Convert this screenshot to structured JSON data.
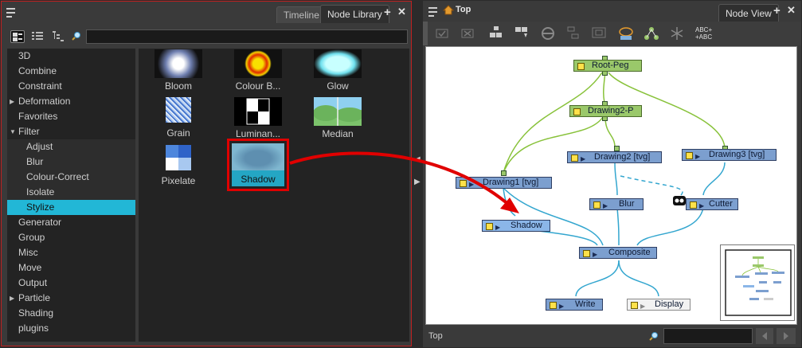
{
  "left_panel": {
    "tabs": [
      {
        "label": "Timeline"
      },
      {
        "label": "Node Library"
      }
    ],
    "add_label": "+",
    "close_label": "✕",
    "search": {
      "value": "",
      "placeholder": ""
    },
    "categories": [
      {
        "label": "3D",
        "level": 0,
        "expander": ""
      },
      {
        "label": "Combine",
        "level": 0,
        "expander": ""
      },
      {
        "label": "Constraint",
        "level": 0,
        "expander": ""
      },
      {
        "label": "Deformation",
        "level": 0,
        "expander": "▶"
      },
      {
        "label": "Favorites",
        "level": 0,
        "expander": ""
      },
      {
        "label": "Filter",
        "level": 0,
        "expander": "▼"
      },
      {
        "label": "Adjust",
        "level": 1,
        "expander": ""
      },
      {
        "label": "Blur",
        "level": 1,
        "expander": ""
      },
      {
        "label": "Colour-Correct",
        "level": 1,
        "expander": ""
      },
      {
        "label": "Isolate",
        "level": 1,
        "expander": ""
      },
      {
        "label": "Stylize",
        "level": 1,
        "expander": "",
        "selected": true
      },
      {
        "label": "Generator",
        "level": 0,
        "expander": ""
      },
      {
        "label": "Group",
        "level": 0,
        "expander": ""
      },
      {
        "label": "Misc",
        "level": 0,
        "expander": ""
      },
      {
        "label": "Move",
        "level": 0,
        "expander": ""
      },
      {
        "label": "Output",
        "level": 0,
        "expander": ""
      },
      {
        "label": "Particle",
        "level": 0,
        "expander": "▶"
      },
      {
        "label": "Shading",
        "level": 0,
        "expander": ""
      },
      {
        "label": "plugins",
        "level": 0,
        "expander": ""
      }
    ],
    "nodes": [
      {
        "label": "Bloom"
      },
      {
        "label": "Colour B..."
      },
      {
        "label": "Glow"
      },
      {
        "label": "Grain"
      },
      {
        "label": "Luminan..."
      },
      {
        "label": "Median"
      },
      {
        "label": "Pixelate"
      },
      {
        "label": "Shadow",
        "selected": true
      }
    ]
  },
  "right_panel": {
    "title": "Top",
    "tab": "Node View",
    "add_label": "+",
    "close_label": "✕",
    "toolbar_text_icon": "ABC+\n+ABC",
    "status_text": "Top",
    "search": {
      "value": "",
      "placeholder": ""
    },
    "graph_nodes": {
      "root_peg": "Root-Peg",
      "drawing2p": "Drawing2-P",
      "drawing2": "Drawing2 [tvg]",
      "drawing3": "Drawing3 [tvg]",
      "drawing1": "Drawing1 [tvg]",
      "blur": "Blur",
      "cutter": "Cutter",
      "shadow": "Shadow",
      "composite": "Composite",
      "write": "Write",
      "display": "Display"
    }
  },
  "colors": {
    "accent": "#22b7d6",
    "highlight_red": "#e00000",
    "peg_green": "#9ac86a",
    "node_blue": "#7c9fcf",
    "wire_blue": "#33a6cf",
    "wire_green": "#88c23a"
  }
}
